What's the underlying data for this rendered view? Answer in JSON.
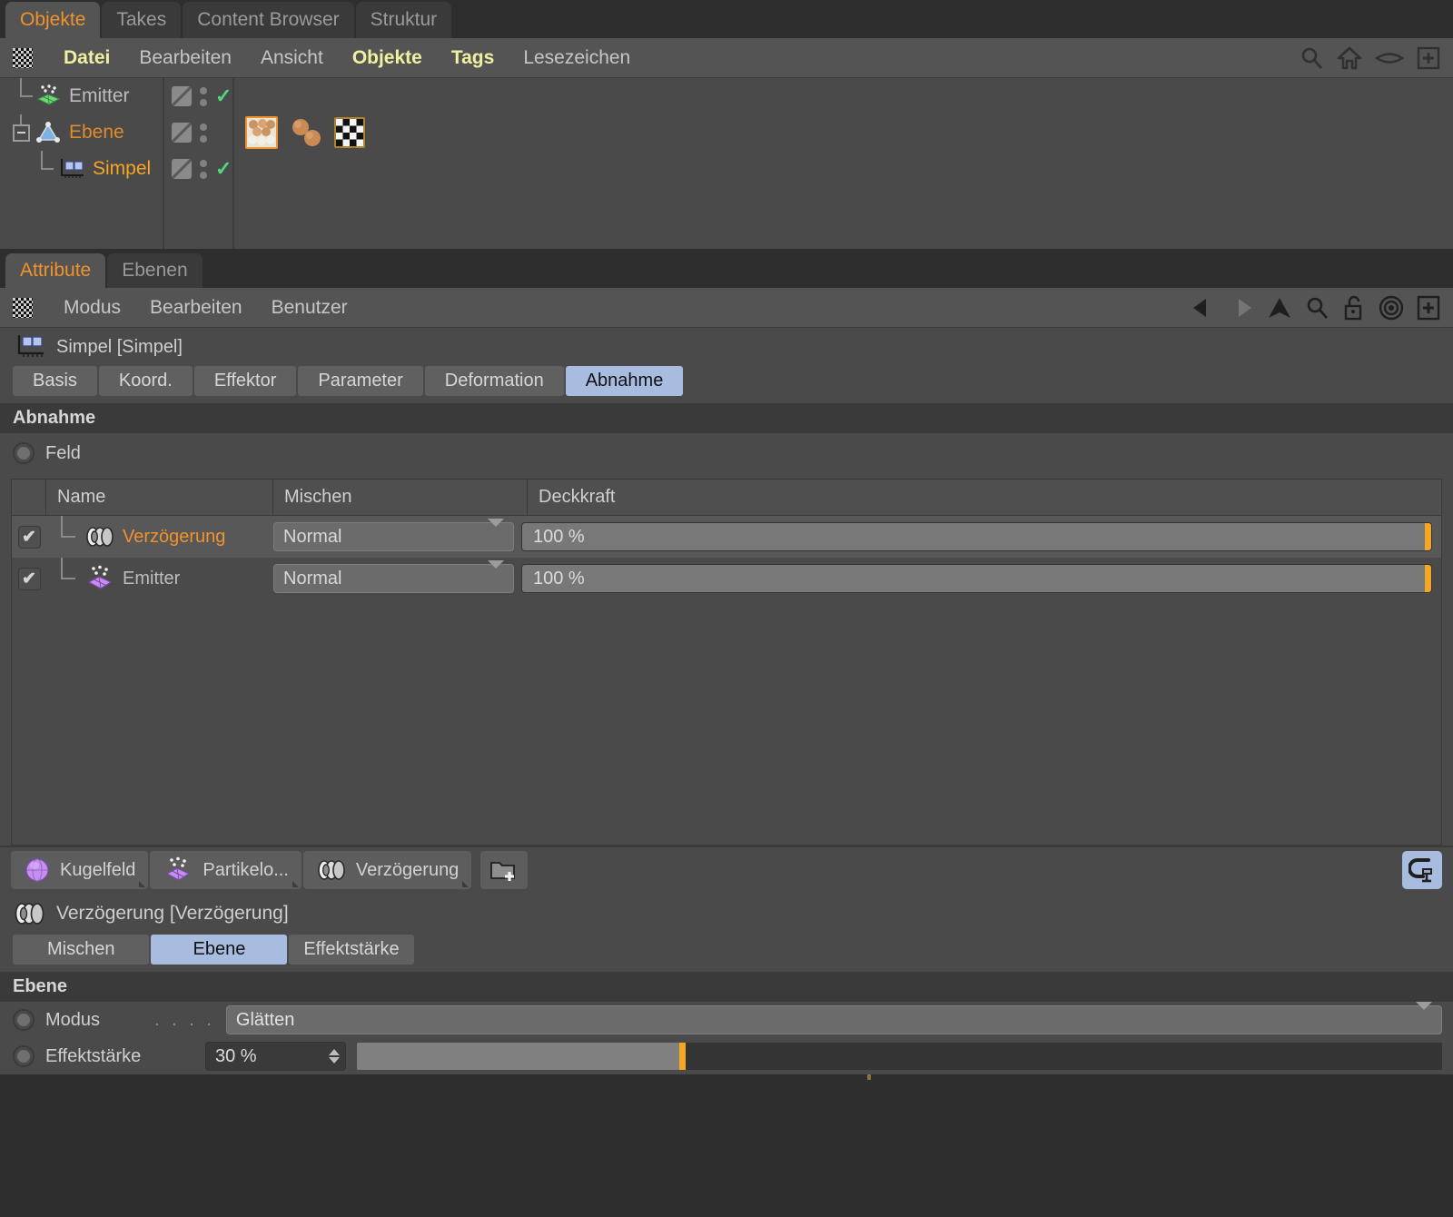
{
  "window_tabs": [
    {
      "label": "Objekte",
      "active": true
    },
    {
      "label": "Takes",
      "active": false
    },
    {
      "label": "Content Browser",
      "active": false
    },
    {
      "label": "Struktur",
      "active": false
    }
  ],
  "object_menu": [
    {
      "label": "Datei",
      "highlight": true
    },
    {
      "label": "Bearbeiten",
      "highlight": false
    },
    {
      "label": "Ansicht",
      "highlight": false
    },
    {
      "label": "Objekte",
      "highlight": true
    },
    {
      "label": "Tags",
      "highlight": true
    },
    {
      "label": "Lesezeichen",
      "highlight": false
    }
  ],
  "object_toolbar_icons": [
    "search-icon",
    "home-icon",
    "eye-icon",
    "add-icon"
  ],
  "object_tree": [
    {
      "name": "Emitter",
      "icon": "particle-emitter-icon",
      "state": "normal",
      "checked": true,
      "indent": 1
    },
    {
      "name": "Ebene",
      "icon": "plane-object-icon",
      "state": "selected",
      "checked": false,
      "indent": 0,
      "expander": "minus"
    },
    {
      "name": "Simpel",
      "icon": "mograph-simple-effector-icon",
      "state": "active",
      "checked": true,
      "indent": 2
    }
  ],
  "object_tags": [
    {
      "name": "mograph-cloner-tag",
      "selected": true
    },
    {
      "name": "dynamics-body-tag",
      "selected": false
    },
    {
      "name": "texture-tag",
      "selected": false
    }
  ],
  "attribute_tabs": [
    {
      "label": "Attribute",
      "active": true
    },
    {
      "label": "Ebenen",
      "active": false
    }
  ],
  "attribute_menu": [
    {
      "label": "Modus"
    },
    {
      "label": "Bearbeiten"
    },
    {
      "label": "Benutzer"
    }
  ],
  "attribute_toolbar_icons": [
    "back-arrow-icon",
    "forward-arrow-icon",
    "up-arrow-icon",
    "search-icon",
    "lock-icon",
    "target-icon",
    "add-icon"
  ],
  "object_header": {
    "title": "Simpel [Simpel]",
    "icon": "mograph-simple-effector-icon"
  },
  "subtabs": [
    {
      "label": "Basis",
      "active": false
    },
    {
      "label": "Koord.",
      "active": false
    },
    {
      "label": "Effektor",
      "active": false
    },
    {
      "label": "Parameter",
      "active": false
    },
    {
      "label": "Deformation",
      "active": false
    },
    {
      "label": "Abnahme",
      "active": true
    }
  ],
  "falloff": {
    "section_title": "Abnahme",
    "field_label": "Feld",
    "columns": [
      "",
      "Name",
      "Mischen",
      "Deckkraft"
    ],
    "rows": [
      {
        "checked": true,
        "icon": "delay-field-icon",
        "name": "Verzögerung",
        "blend": "Normal",
        "opacity": "100 %",
        "opacity_value": 100,
        "selected": true
      },
      {
        "checked": true,
        "icon": "particle-emitter-field-icon",
        "name": "Emitter",
        "blend": "Normal",
        "opacity": "100 %",
        "opacity_value": 100,
        "selected": false
      }
    ]
  },
  "field_buttons": [
    {
      "label": "Kugelfeld",
      "icon": "sphere-field-icon"
    },
    {
      "label": "Partikelo...",
      "icon": "particle-emitter-field-icon"
    },
    {
      "label": "Verzögerung",
      "icon": "delay-field-icon"
    },
    {
      "label": "",
      "icon": "new-folder-icon"
    }
  ],
  "clamp_button": {
    "icon": "clamp-icon"
  },
  "detail": {
    "header_title": "Verzögerung [Verzögerung]",
    "header_icon": "delay-field-icon",
    "tabs": [
      {
        "label": "Mischen",
        "active": false
      },
      {
        "label": "Ebene",
        "active": true
      },
      {
        "label": "Effektstärke",
        "active": false
      }
    ],
    "section_title": "Ebene",
    "params": [
      {
        "label": "Modus",
        "dots": ". . . .",
        "type": "dropdown",
        "value": "Glätten"
      },
      {
        "label": "Effektstärke",
        "dots": "",
        "type": "slider",
        "value": "30 %",
        "percent": 30
      }
    ]
  },
  "colors": {
    "accent_orange": "#f0932b",
    "slider_handle": "#f5a623",
    "tab_active_blue": "#a8bce0",
    "panel_bg": "#4a4a4a",
    "menu_bg": "#545454",
    "menu_highlight": "#f2f0a0",
    "check_green": "#4ed97a"
  }
}
